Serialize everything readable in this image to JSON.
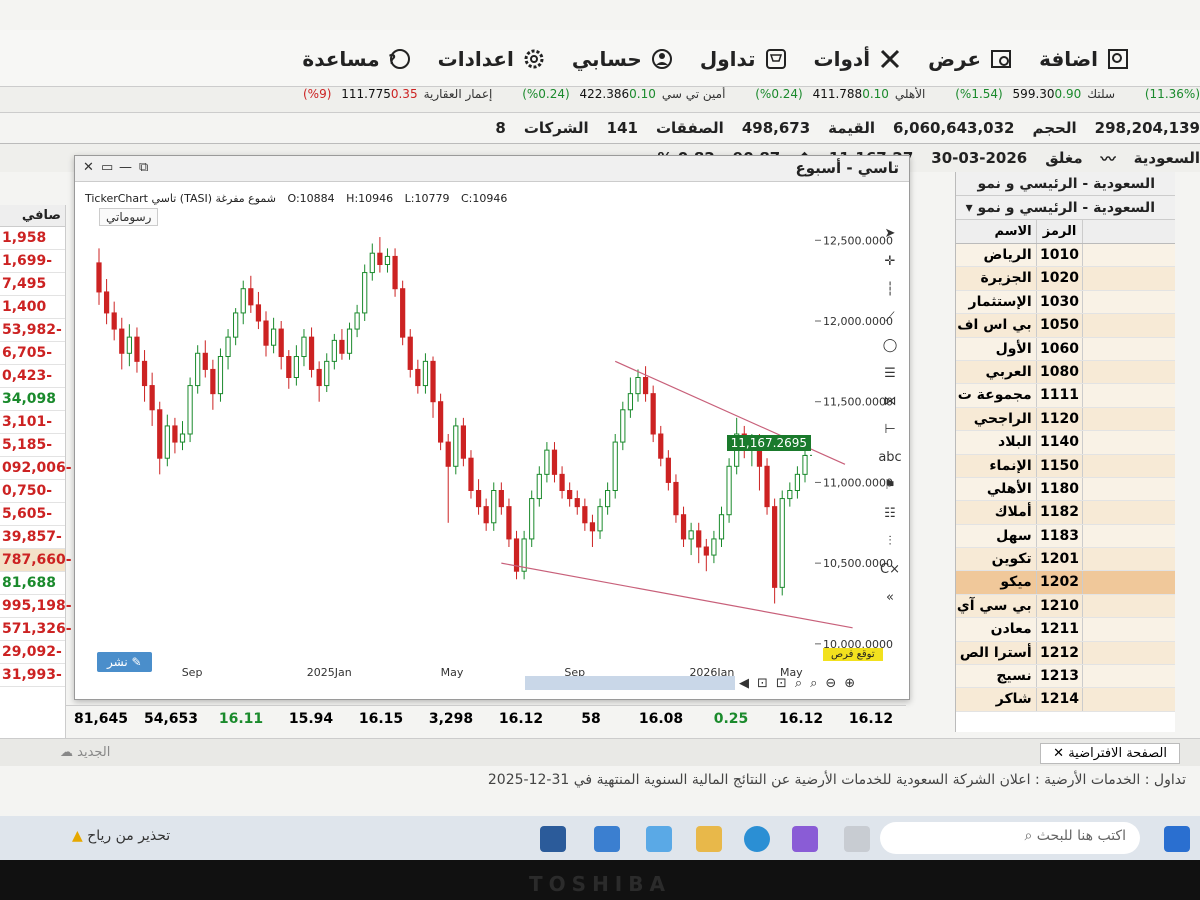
{
  "menu": [
    {
      "label": "اضافة",
      "icon": "add-icon"
    },
    {
      "label": "عرض",
      "icon": "view-icon"
    },
    {
      "label": "أدوات",
      "icon": "tools-icon"
    },
    {
      "label": "تداول",
      "icon": "cart-icon"
    },
    {
      "label": "حسابي",
      "icon": "user-icon"
    },
    {
      "label": "اعدادات",
      "icon": "gear-icon"
    },
    {
      "label": "مساعدة",
      "icon": "help-icon"
    }
  ],
  "tickers": [
    {
      "name": "",
      "value": "",
      "change": "",
      "pct": "(11.36%)",
      "dir": "up"
    },
    {
      "name": "سلتك",
      "value": "599.30",
      "change": "0.90",
      "pct": "(1.54%)",
      "dir": "up"
    },
    {
      "name": "الأهلي",
      "value": "411.788",
      "change": "0.10",
      "pct": "(0.24%)",
      "dir": "up"
    },
    {
      "name": "أمين تي سي",
      "value": "422.386",
      "change": "0.10",
      "pct": "(0.24%)",
      "dir": "up"
    },
    {
      "name": "إعمار العقارية",
      "value": "111.775",
      "change": "0.35",
      "pct": "(9%)",
      "dir": "dn"
    }
  ],
  "stats": {
    "companies_label": "الشركات",
    "companies": "141",
    "extra": "8",
    "deals_label": "الصفقات",
    "deals": "498,673",
    "value_label": "القيمة",
    "value": "6,060,643,032",
    "volume_label": "الحجم",
    "volume": "298,204,139"
  },
  "index": {
    "market": "السعودية",
    "status": "مغلق",
    "date": "30-03-2026",
    "last": "11,167.27",
    "change": "90.87",
    "pct": "0.82 %"
  },
  "left_table": {
    "header": "صافي",
    "values": [
      {
        "v": "1,958",
        "c": "r"
      },
      {
        "v": "1,699-",
        "c": "r"
      },
      {
        "v": "7,495",
        "c": "r"
      },
      {
        "v": "1,400",
        "c": "r"
      },
      {
        "v": "53,982-",
        "c": "r"
      },
      {
        "v": "6,705-",
        "c": "r"
      },
      {
        "v": "0,423-",
        "c": "r"
      },
      {
        "v": "34,098",
        "c": "g"
      },
      {
        "v": "3,101-",
        "c": "r"
      },
      {
        "v": "5,185-",
        "c": "r"
      },
      {
        "v": "092,006-",
        "c": "r"
      },
      {
        "v": "0,750-",
        "c": "r"
      },
      {
        "v": "5,605-",
        "c": "r"
      },
      {
        "v": "39,857-",
        "c": "r"
      },
      {
        "v": "787,660-",
        "c": "r",
        "hl": true
      },
      {
        "v": "81,688",
        "c": "g"
      },
      {
        "v": "995,198-",
        "c": "r"
      },
      {
        "v": "571,326-",
        "c": "r"
      },
      {
        "v": "29,092-",
        "c": "r"
      },
      {
        "v": "31,993-",
        "c": "r"
      }
    ]
  },
  "chart_window": {
    "title": "تاسي - أسبوع",
    "source": "TickerChart تاسي (TASI) شموع مفرغة",
    "open": "O:10884",
    "high": "H:10946",
    "low": "L:10779",
    "close": "C:10946",
    "drawings_label": "رسوماتي",
    "share_label": "نشر",
    "yellow_tag": "توقع فرص",
    "last_price_tag": "11,167.2695"
  },
  "chart_data": {
    "type": "candlestick",
    "title": "تاسي - أسبوع",
    "x_ticks": [
      "Sep",
      "2025Jan",
      "May",
      "Sep",
      "2026Jan",
      "May"
    ],
    "y_ticks": [
      10000,
      10500,
      11000,
      11500,
      12000,
      12500
    ],
    "y_tick_labels": [
      "10,000.0000",
      "10,500.0000",
      "11,000.0000",
      "11,500.0000",
      "12,000.0000",
      "12,500.0000"
    ],
    "ylim": [
      9900,
      12700
    ],
    "last": 11167.27,
    "candles": [
      [
        12360,
        12180,
        12450,
        12100
      ],
      [
        12180,
        12050,
        12260,
        11980
      ],
      [
        12050,
        11950,
        12120,
        11880
      ],
      [
        11950,
        11800,
        12020,
        11700
      ],
      [
        11800,
        11900,
        11980,
        11720
      ],
      [
        11900,
        11750,
        11960,
        11680
      ],
      [
        11750,
        11600,
        11820,
        11500
      ],
      [
        11600,
        11450,
        11680,
        11350
      ],
      [
        11450,
        11150,
        11500,
        11050
      ],
      [
        11150,
        11350,
        11420,
        11100
      ],
      [
        11350,
        11250,
        11400,
        11180
      ],
      [
        11250,
        11300,
        11380,
        11200
      ],
      [
        11300,
        11600,
        11650,
        11250
      ],
      [
        11600,
        11800,
        11850,
        11550
      ],
      [
        11800,
        11700,
        11880,
        11650
      ],
      [
        11700,
        11550,
        11760,
        11450
      ],
      [
        11550,
        11780,
        11830,
        11500
      ],
      [
        11780,
        11900,
        11950,
        11700
      ],
      [
        11900,
        12050,
        12080,
        11850
      ],
      [
        12050,
        12200,
        12250,
        11980
      ],
      [
        12200,
        12100,
        12280,
        12050
      ],
      [
        12100,
        12000,
        12180,
        11950
      ],
      [
        12000,
        11850,
        12060,
        11780
      ],
      [
        11850,
        11950,
        12020,
        11800
      ],
      [
        11950,
        11780,
        12000,
        11700
      ],
      [
        11780,
        11650,
        11820,
        11580
      ],
      [
        11650,
        11780,
        11850,
        11600
      ],
      [
        11780,
        11900,
        11950,
        11720
      ],
      [
        11900,
        11700,
        11960,
        11650
      ],
      [
        11700,
        11600,
        11750,
        11500
      ],
      [
        11600,
        11750,
        11800,
        11560
      ],
      [
        11750,
        11880,
        11920,
        11700
      ],
      [
        11880,
        11800,
        11950,
        11760
      ],
      [
        11800,
        11950,
        11990,
        11760
      ],
      [
        11950,
        12050,
        12100,
        11900
      ],
      [
        12050,
        12300,
        12350,
        12000
      ],
      [
        12300,
        12420,
        12480,
        12250
      ],
      [
        12420,
        12350,
        12520,
        12300
      ],
      [
        12350,
        12400,
        12450,
        12300
      ],
      [
        12400,
        12200,
        12450,
        12150
      ],
      [
        12200,
        11900,
        12250,
        11850
      ],
      [
        11900,
        11700,
        11950,
        11650
      ],
      [
        11700,
        11600,
        11760,
        11550
      ],
      [
        11600,
        11750,
        11800,
        11550
      ],
      [
        11750,
        11500,
        11780,
        11400
      ],
      [
        11500,
        11250,
        11550,
        11200
      ],
      [
        11250,
        11100,
        11300,
        10750
      ],
      [
        11100,
        11350,
        11400,
        11050
      ],
      [
        11350,
        11150,
        11400,
        11100
      ],
      [
        11150,
        10950,
        11200,
        10900
      ],
      [
        10950,
        10850,
        11020,
        10800
      ],
      [
        10850,
        10750,
        10900,
        10700
      ],
      [
        10750,
        10950,
        11000,
        10700
      ],
      [
        10950,
        10850,
        11000,
        10800
      ],
      [
        10850,
        10650,
        10900,
        10600
      ],
      [
        10650,
        10450,
        10700,
        10400
      ],
      [
        10450,
        10650,
        10700,
        10400
      ],
      [
        10650,
        10900,
        10950,
        10600
      ],
      [
        10900,
        11050,
        11100,
        10850
      ],
      [
        11050,
        11200,
        11250,
        11000
      ],
      [
        11200,
        11050,
        11250,
        11000
      ],
      [
        11050,
        10950,
        11100,
        10900
      ],
      [
        10950,
        10900,
        11000,
        10850
      ],
      [
        10900,
        10850,
        10950,
        10800
      ],
      [
        10850,
        10750,
        10900,
        10700
      ],
      [
        10750,
        10700,
        10800,
        10600
      ],
      [
        10700,
        10850,
        10900,
        10650
      ],
      [
        10850,
        10950,
        11000,
        10800
      ],
      [
        10950,
        11250,
        11300,
        10900
      ],
      [
        11250,
        11450,
        11500,
        11200
      ],
      [
        11450,
        11550,
        11650,
        11400
      ],
      [
        11550,
        11650,
        11700,
        11500
      ],
      [
        11650,
        11550,
        11720,
        11500
      ],
      [
        11550,
        11300,
        11600,
        11250
      ],
      [
        11300,
        11150,
        11350,
        11100
      ],
      [
        11150,
        11000,
        11200,
        10950
      ],
      [
        11000,
        10800,
        11050,
        10750
      ],
      [
        10800,
        10650,
        10850,
        10600
      ],
      [
        10650,
        10700,
        10750,
        10550
      ],
      [
        10700,
        10600,
        10750,
        10500
      ],
      [
        10600,
        10550,
        10650,
        10450
      ],
      [
        10550,
        10650,
        10700,
        10500
      ],
      [
        10650,
        10800,
        10850,
        10600
      ],
      [
        10800,
        11100,
        11150,
        10750
      ],
      [
        11100,
        11300,
        11400,
        11050
      ],
      [
        11300,
        11200,
        11350,
        11150
      ],
      [
        11200,
        11250,
        11300,
        11100
      ],
      [
        11250,
        11100,
        11300,
        10950
      ],
      [
        11100,
        10850,
        11150,
        10800
      ],
      [
        10850,
        10350,
        10900,
        10250
      ],
      [
        10350,
        10900,
        10950,
        10300
      ],
      [
        10900,
        10950,
        11000,
        10850
      ],
      [
        10950,
        11050,
        11100,
        10900
      ],
      [
        11050,
        11167,
        11200,
        11000
      ]
    ],
    "trendline_upper": {
      "from": [
        68,
        11750
      ],
      "to": [
        93,
        11050
      ]
    },
    "trendline_lower": {
      "from": [
        53,
        10500
      ],
      "to": [
        94,
        10050
      ]
    }
  },
  "watchlist": {
    "title": "السعودية - الرئيسي و نمو",
    "col_name": "الاسم",
    "col_symbol": "الرمز",
    "rows": [
      {
        "name": "الرياض",
        "symbol": "1010"
      },
      {
        "name": "الجزيرة",
        "symbol": "1020"
      },
      {
        "name": "الإستثمار",
        "symbol": "1030"
      },
      {
        "name": "بي اس اف",
        "symbol": "1050"
      },
      {
        "name": "الأول",
        "symbol": "1060"
      },
      {
        "name": "العربي",
        "symbol": "1080"
      },
      {
        "name": "مجموعة ت",
        "symbol": "1111"
      },
      {
        "name": "الراجحي",
        "symbol": "1120"
      },
      {
        "name": "البلاد",
        "symbol": "1140"
      },
      {
        "name": "الإنماء",
        "symbol": "1150"
      },
      {
        "name": "الأهلي",
        "symbol": "1180"
      },
      {
        "name": "أملاك",
        "symbol": "1182"
      },
      {
        "name": "سهل",
        "symbol": "1183"
      },
      {
        "name": "تكوين",
        "symbol": "1201"
      },
      {
        "name": "ميكو",
        "symbol": "1202",
        "selected": true
      },
      {
        "name": "بي سي آي",
        "symbol": "1210"
      },
      {
        "name": "معادن",
        "symbol": "1211"
      },
      {
        "name": "أسترا الص",
        "symbol": "1212"
      },
      {
        "name": "نسيج",
        "symbol": "1213"
      },
      {
        "name": "شاكر",
        "symbol": "1214"
      }
    ]
  },
  "bottom_row": [
    "81,645",
    "54,653",
    "16.11",
    "15.94",
    "16.15",
    "3,298",
    "16.12",
    "58",
    "16.08",
    "0.25",
    "16.12",
    "16.12"
  ],
  "tabs": {
    "default": "الصفحة الافتراضية",
    "new": "الجديد"
  },
  "news": {
    "line1": "تداول : الخدمات الأرضية : اعلان الشركة السعودية للخدمات الأرضية عن النتائج المالية السنوية المنتهية في 31-12-2025"
  },
  "taskbar": {
    "search_placeholder": "اكتب هنا للبحث",
    "warning": "تحذير من رياح"
  },
  "brand": "TOSHIBA",
  "colors": {
    "up": "#1a8a2c",
    "down": "#c22",
    "accent": "#4a8ecb",
    "trend": "#c8607a"
  }
}
